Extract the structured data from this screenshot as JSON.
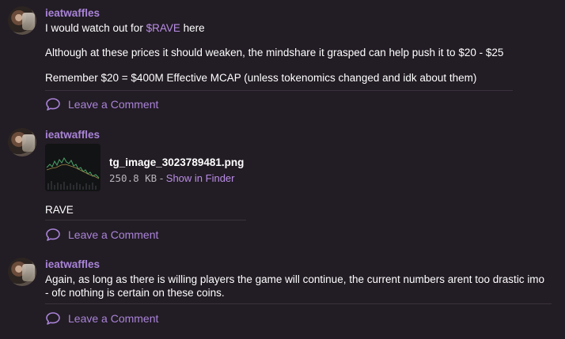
{
  "posts": [
    {
      "username": "ieatwaffles",
      "line1_prefix": "I would watch out for ",
      "line1_ticker": "$RAVE",
      "line1_suffix": " here",
      "line2": "Although at these prices it should weaken, the mindshare it grasped can help push it to $20 - $25",
      "line3": "Remember $20 = $400M Effective MCAP (unless tokenomics changed and idk about them)",
      "comment_label": "Leave a Comment"
    },
    {
      "username": "ieatwaffles",
      "attachment": {
        "filename": "tg_image_3023789481.png",
        "size": "250.8 KB",
        "separator": " - ",
        "action": "Show in Finder"
      },
      "text": "RAVE",
      "comment_label": "Leave a Comment"
    },
    {
      "username": "ieatwaffles",
      "line1": "Again, as long as there is willing players the game will continue, the current numbers arent too drastic imo",
      "line2": "- ofc nothing is certain on these coins.",
      "comment_label": "Leave a Comment"
    }
  ],
  "colors": {
    "background": "#221c24",
    "accent": "#a984d8",
    "text": "#ffffff"
  },
  "icons": [
    "avatar",
    "comment-icon"
  ]
}
